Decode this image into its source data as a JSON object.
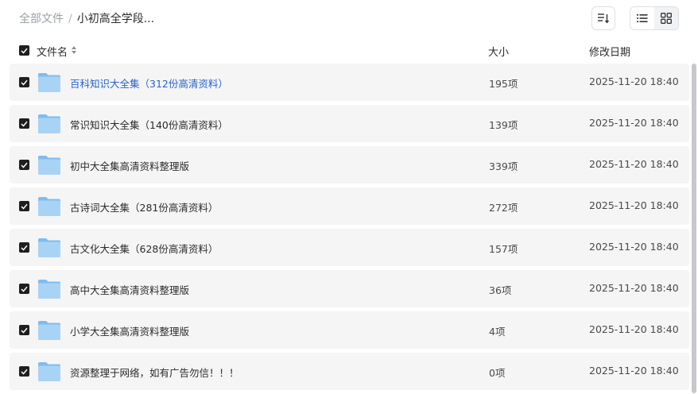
{
  "breadcrumb": {
    "root": "全部文件",
    "separator": "/",
    "current": "小初高全学段..."
  },
  "toolbar": {
    "sort_icon": "sort-icon",
    "list_view_icon": "list-view-icon",
    "grid_view_icon": "grid-view-icon"
  },
  "header": {
    "name": "文件名",
    "size": "大小",
    "modified": "修改日期"
  },
  "files": [
    {
      "name": "百科知识大全集（312份高清资料）",
      "size": "195项",
      "modified": "2025-11-20 18:40"
    },
    {
      "name": "常识知识大全集（140份高清资料）",
      "size": "139项",
      "modified": "2025-11-20 18:40"
    },
    {
      "name": "初中大全集高清资料整理版",
      "size": "339项",
      "modified": "2025-11-20 18:40"
    },
    {
      "name": "古诗词大全集（281份高清资料）",
      "size": "272项",
      "modified": "2025-11-20 18:40"
    },
    {
      "name": "古文化大全集（628份高清资料）",
      "size": "157项",
      "modified": "2025-11-20 18:40"
    },
    {
      "name": "高中大全集高清资料整理版",
      "size": "36项",
      "modified": "2025-11-20 18:40"
    },
    {
      "name": "小学大全集高清资料整理版",
      "size": "4项",
      "modified": "2025-11-20 18:40"
    },
    {
      "name": "资源整理于网络，如有广告勿信！！！",
      "size": "0项",
      "modified": "2025-11-20 18:40"
    }
  ],
  "colors": {
    "link": "#2864c8",
    "folder_light": "#a9d3f5",
    "folder_dark": "#7fbcee",
    "row_bg": "#f5f5f6"
  }
}
